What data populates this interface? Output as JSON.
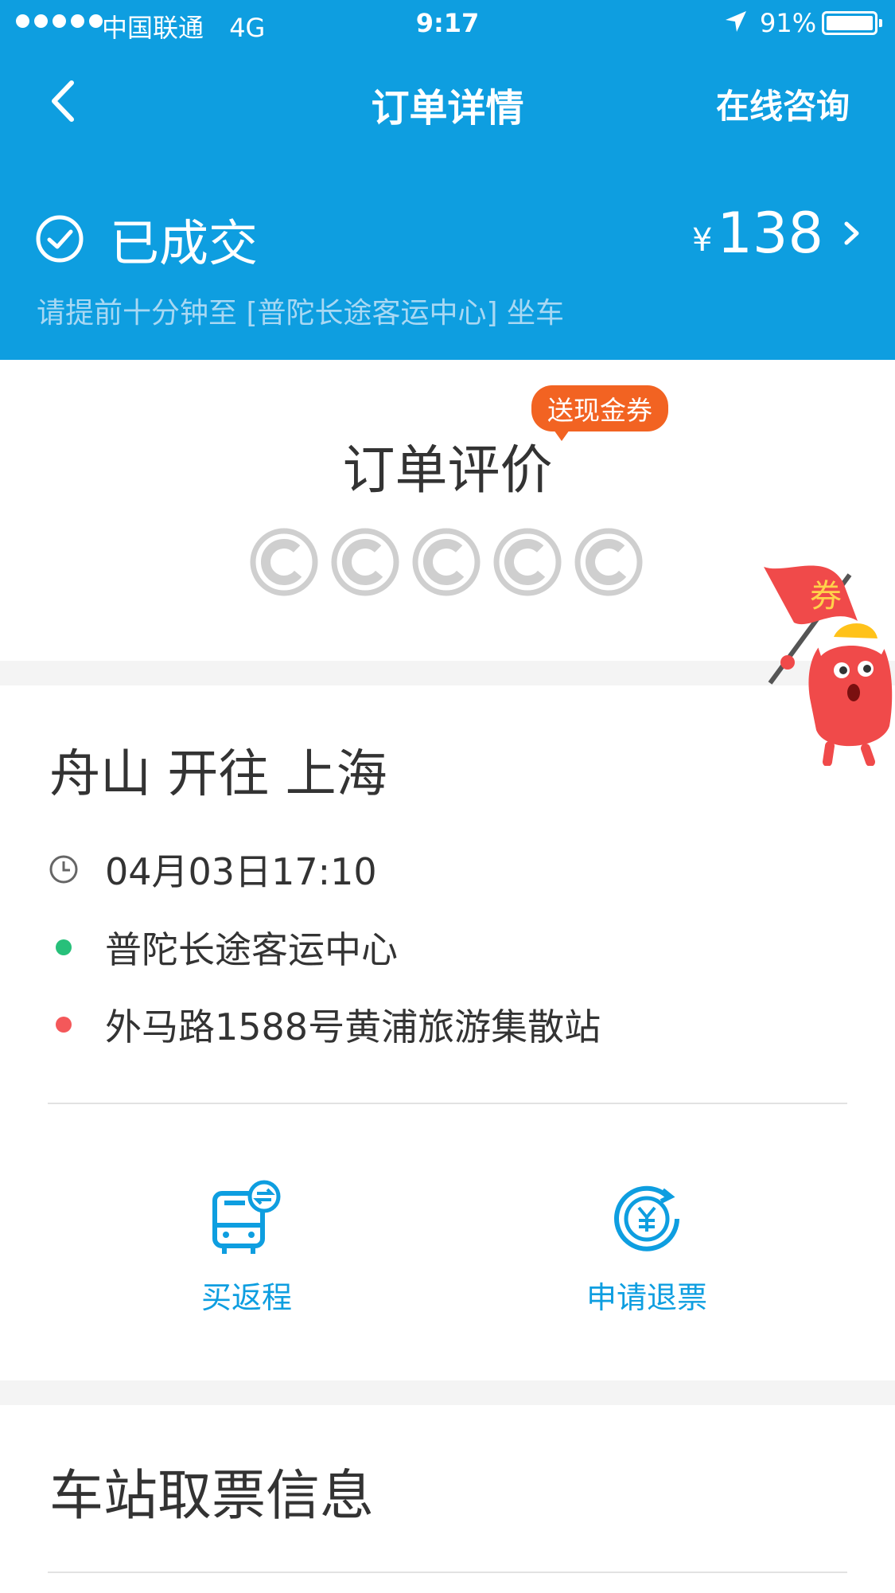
{
  "status_bar": {
    "carrier": "中国联通",
    "network": "4G",
    "time": "9:17",
    "battery": "91%"
  },
  "nav": {
    "title": "订单详情",
    "consult": "在线咨询"
  },
  "order": {
    "status": "已成交",
    "currency": "¥",
    "price": "138",
    "notice": "请提前十分钟至 [普陀长途客运中心] 坐车"
  },
  "rating": {
    "title": "订单评价",
    "coupon_tag": "送现金券",
    "mascot_flag": "券",
    "star_count": 5
  },
  "trip": {
    "route": "舟山 开往 上海",
    "datetime": "04月03日17:10",
    "origin": "普陀长途客运中心",
    "destination": "外马路1588号黄浦旅游集散站"
  },
  "actions": {
    "return_trip": "买返程",
    "refund": "申请退票"
  },
  "ticket_info": {
    "title": "车站取票信息"
  },
  "colors": {
    "brand": "#0e9ee0",
    "origin_dot": "#27c07a",
    "destination_dot": "#f4585a",
    "coupon": "#f26322"
  }
}
